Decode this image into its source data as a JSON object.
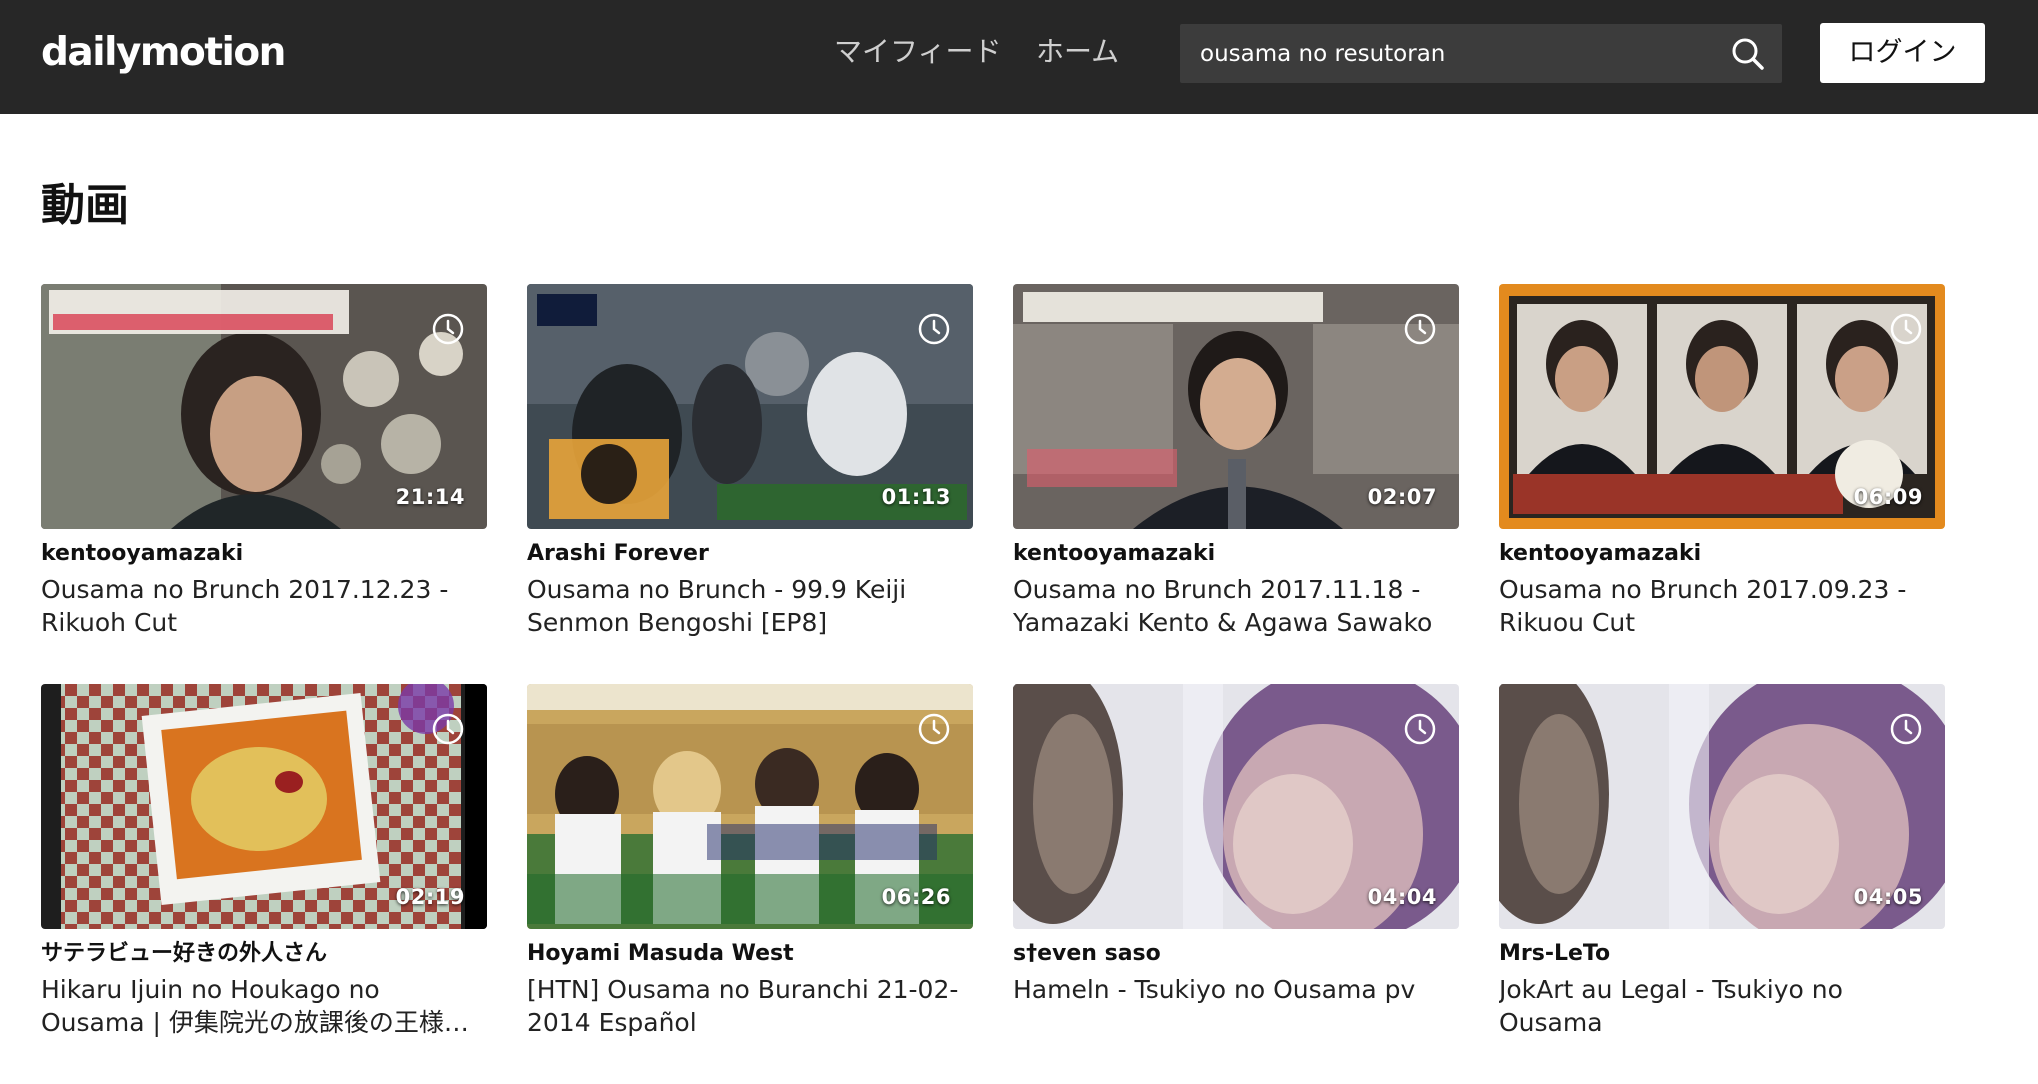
{
  "header": {
    "logo": "dailymotion",
    "nav": {
      "myfeed": "マイフィード",
      "home": "ホーム"
    },
    "search": {
      "value": "ousama no resutoran",
      "placeholder": ""
    },
    "login_label": "ログイン"
  },
  "section_title": "動画",
  "videos": [
    {
      "channel": "kentooyamazaki",
      "title": "Ousama no Brunch 2017.12.23 - Rikuoh Cut",
      "duration": "21:14"
    },
    {
      "channel": "Arashi Forever",
      "title": "Ousama no Brunch - 99.9 Keiji Senmon Bengoshi [EP8]",
      "duration": "01:13"
    },
    {
      "channel": "kentooyamazaki",
      "title": "Ousama no Brunch 2017.11.18 - Yamazaki Kento & Agawa Sawako",
      "duration": "02:07"
    },
    {
      "channel": "kentooyamazaki",
      "title": "Ousama no Brunch 2017.09.23 - Rikuou Cut",
      "duration": "06:09"
    },
    {
      "channel": "サテラビュー好きの外人さん",
      "title": "Hikaru Ijuin no Houkago no Ousama | 伊集院光の放課後の王様 (Satellaview)",
      "duration": "02:19"
    },
    {
      "channel": "Hoyami Masuda West",
      "title": "[HTN] Ousama no Buranchi 21-02-2014 Español",
      "duration": "06:26"
    },
    {
      "channel": "s†even saso",
      "title": "Hameln - Tsukiyo no Ousama pv",
      "duration": "04:04"
    },
    {
      "channel": "Mrs-LeTo",
      "title": "JokArt au Legal - Tsukiyo no Ousama",
      "duration": "04:05"
    }
  ],
  "icons": {
    "search": "search-icon",
    "watch_later": "clock-icon"
  },
  "colors": {
    "header_bg": "#272727",
    "search_bg": "#3c3c3c",
    "page_bg": "#ffffff"
  }
}
